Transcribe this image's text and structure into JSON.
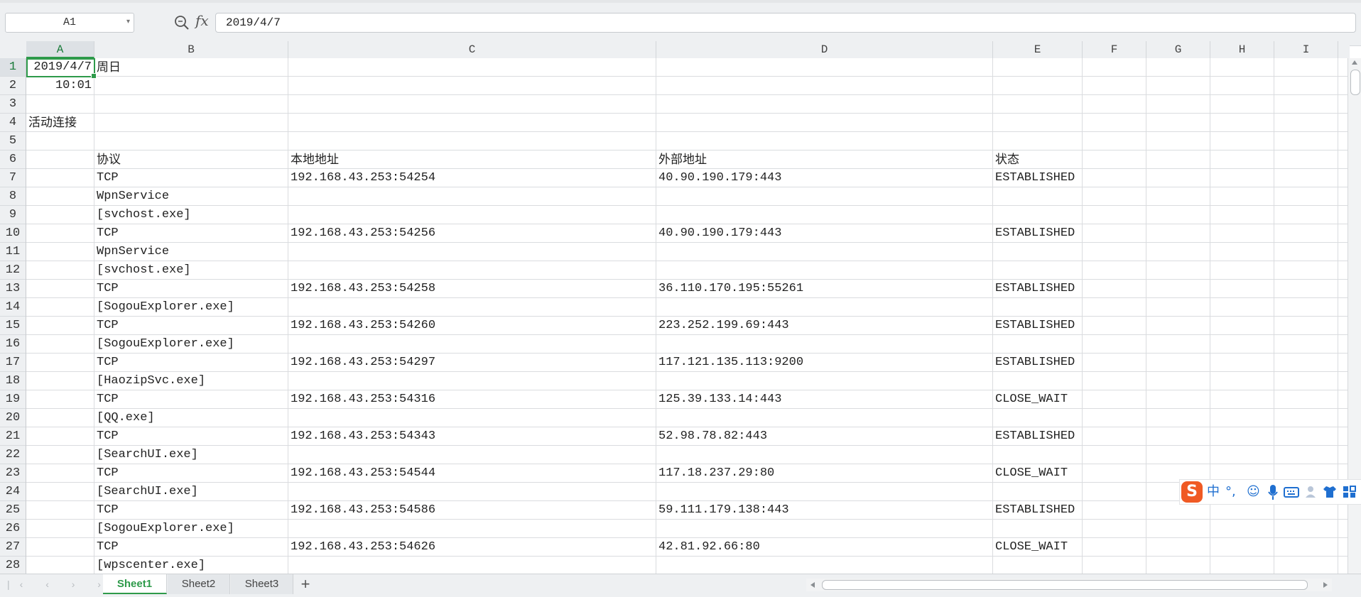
{
  "formula_bar": {
    "name_box": "A1",
    "formula_value": "2019/4/7",
    "fx_label": "fx"
  },
  "columns": [
    "A",
    "B",
    "C",
    "D",
    "E",
    "F",
    "G",
    "H",
    "I"
  ],
  "rows": [
    "1",
    "2",
    "3",
    "4",
    "5",
    "6",
    "7",
    "8",
    "9",
    "10",
    "11",
    "12",
    "13",
    "14",
    "15",
    "16",
    "17",
    "18",
    "19",
    "20",
    "21",
    "22",
    "23",
    "24",
    "25",
    "26",
    "27",
    "28"
  ],
  "cells": {
    "A1": "2019/4/7",
    "B1": "周日",
    "A2": "10:01",
    "A4": "活动连接",
    "B6": "协议",
    "C6": "本地地址",
    "D6": "外部地址",
    "E6": "状态",
    "B7": "TCP",
    "C7": "192.168.43.253:54254",
    "D7": "40.90.190.179:443",
    "E7": "ESTABLISHED",
    "B8": "WpnService",
    "B9": "[svchost.exe]",
    "B10": "TCP",
    "C10": "192.168.43.253:54256",
    "D10": "40.90.190.179:443",
    "E10": "ESTABLISHED",
    "B11": "WpnService",
    "B12": "[svchost.exe]",
    "B13": "TCP",
    "C13": "192.168.43.253:54258",
    "D13": "36.110.170.195:55261",
    "E13": "ESTABLISHED",
    "B14": "[SogouExplorer.exe]",
    "B15": "TCP",
    "C15": "192.168.43.253:54260",
    "D15": "223.252.199.69:443",
    "E15": "ESTABLISHED",
    "B16": "[SogouExplorer.exe]",
    "B17": "TCP",
    "C17": "192.168.43.253:54297",
    "D17": "117.121.135.113:9200",
    "E17": "ESTABLISHED",
    "B18": "[HaozipSvc.exe]",
    "B19": "TCP",
    "C19": "192.168.43.253:54316",
    "D19": "125.39.133.14:443",
    "E19": "CLOSE_WAIT",
    "B20": "[QQ.exe]",
    "B21": "TCP",
    "C21": "192.168.43.253:54343",
    "D21": "52.98.78.82:443",
    "E21": "ESTABLISHED",
    "B22": "[SearchUI.exe]",
    "B23": "TCP",
    "C23": "192.168.43.253:54544",
    "D23": "117.18.237.29:80",
    "E23": "CLOSE_WAIT",
    "B24": "[SearchUI.exe]",
    "B25": "TCP",
    "C25": "192.168.43.253:54586",
    "D25": "59.111.179.138:443",
    "E25": "ESTABLISHED",
    "B26": "[SogouExplorer.exe]",
    "B27": "TCP",
    "C27": "192.168.43.253:54626",
    "D27": "42.81.92.66:80",
    "E27": "CLOSE_WAIT",
    "B28": "[wpscenter.exe]"
  },
  "sheets": [
    "Sheet1",
    "Sheet2",
    "Sheet3"
  ],
  "active_sheet": "Sheet1",
  "active_cell": "A1",
  "ime_toolbar": {
    "logo": "S",
    "items": [
      "中",
      "°,",
      "☺",
      "mic-icon",
      "keyboard-icon",
      "user-icon",
      "shirt-icon",
      "grid-icon"
    ]
  },
  "colors": {
    "accent": "#2e9a4a",
    "header_bg": "#eef0f2",
    "grid": "#dadcdf"
  }
}
